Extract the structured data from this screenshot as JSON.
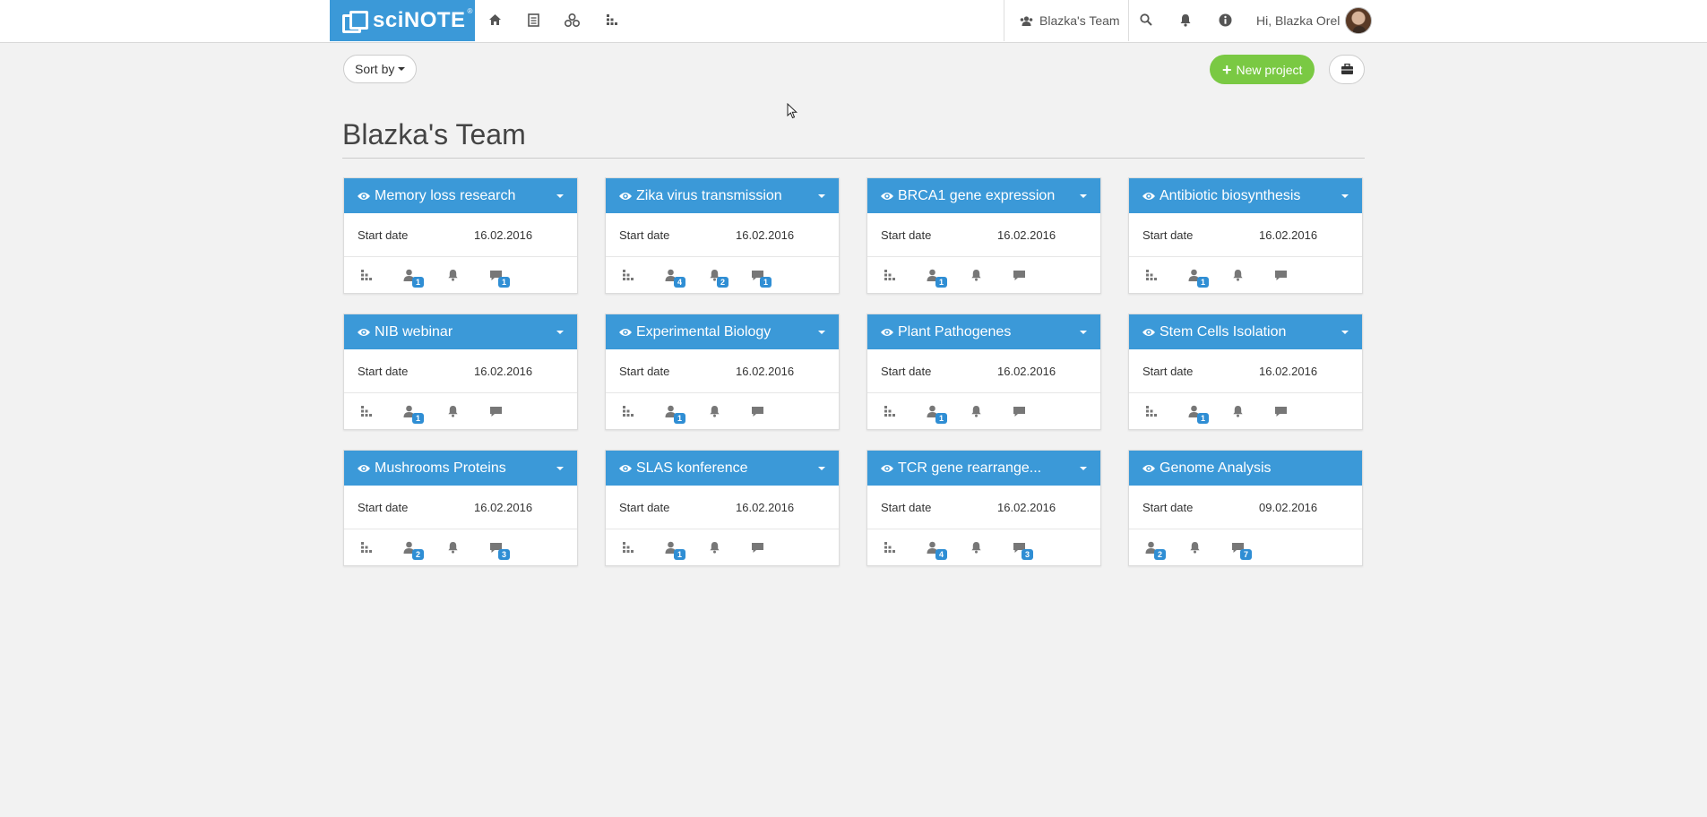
{
  "brand": {
    "name": "sciNOTE",
    "reg": "®"
  },
  "header": {
    "nav_icons": [
      "home-icon",
      "list-icon",
      "protocols-icon",
      "reports-icon"
    ],
    "team": "Blazka's Team",
    "greeting": "Hi, Blazka Orel"
  },
  "toolbar": {
    "sort_label": "Sort by",
    "new_project_label": "New project"
  },
  "page": {
    "title": "Blazka's Team"
  },
  "colors": {
    "accent": "#3b99d8",
    "success": "#7ac943",
    "badge": "#2f8ed4"
  },
  "start_date_label": "Start date",
  "projects": [
    {
      "name": "Memory loss research",
      "date": "16.02.2016",
      "users": "1",
      "notifications": "",
      "comments": "1"
    },
    {
      "name": "Zika virus transmission",
      "date": "16.02.2016",
      "users": "4",
      "notifications": "2",
      "comments": "1"
    },
    {
      "name": "BRCA1 gene expression",
      "date": "16.02.2016",
      "users": "1",
      "notifications": "",
      "comments": ""
    },
    {
      "name": "Antibiotic biosynthesis",
      "date": "16.02.2016",
      "users": "1",
      "notifications": "",
      "comments": ""
    },
    {
      "name": "NIB webinar",
      "date": "16.02.2016",
      "users": "1",
      "notifications": "",
      "comments": ""
    },
    {
      "name": "Experimental Biology",
      "date": "16.02.2016",
      "users": "1",
      "notifications": "",
      "comments": ""
    },
    {
      "name": "Plant Pathogenes",
      "date": "16.02.2016",
      "users": "1",
      "notifications": "",
      "comments": ""
    },
    {
      "name": "Stem Cells Isolation",
      "date": "16.02.2016",
      "users": "1",
      "notifications": "",
      "comments": ""
    },
    {
      "name": "Mushrooms Proteins",
      "date": "16.02.2016",
      "users": "2",
      "notifications": "",
      "comments": "3"
    },
    {
      "name": "SLAS konference",
      "date": "16.02.2016",
      "users": "1",
      "notifications": "",
      "comments": ""
    },
    {
      "name": "TCR gene rearrange...",
      "date": "16.02.2016",
      "users": "4",
      "notifications": "",
      "comments": "3"
    },
    {
      "name": "Genome Analysis",
      "date": "09.02.2016",
      "users": "2",
      "notifications": "",
      "comments": "7",
      "no_reports": true,
      "no_dropdown": true
    }
  ]
}
